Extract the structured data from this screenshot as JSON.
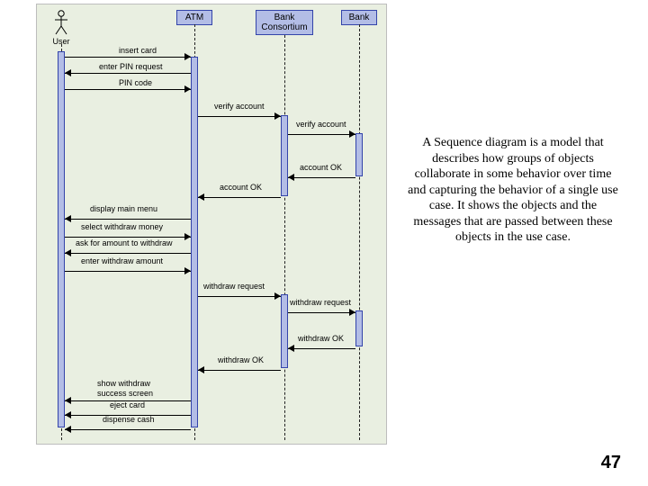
{
  "participants": {
    "user": "User",
    "atm": "ATM",
    "consortium_line1": "Bank",
    "consortium_line2": "Consortium",
    "bank": "Bank"
  },
  "messages": {
    "insert_card": "insert card",
    "enter_pin_request": "enter PIN request",
    "pin_code": "PIN code",
    "verify_account_1": "verify account",
    "verify_account_2": "verify account",
    "account_ok_1": "account OK",
    "account_ok_2": "account OK",
    "display_main_menu": "display main menu",
    "select_withdraw_money": "select withdraw money",
    "ask_for_amount": "ask for amount to withdraw",
    "enter_withdraw_amount": "enter withdraw amount",
    "withdraw_request_1": "withdraw request",
    "withdraw_request_2": "withdraw request",
    "withdraw_ok_1": "withdraw OK",
    "withdraw_ok_2": "withdraw OK",
    "show_withdraw_line1": "show withdraw",
    "show_withdraw_line2": "success screen",
    "eject_card": "eject card",
    "dispense_cash": "dispense cash"
  },
  "description": "A Sequence diagram is a model that describes how groups of objects collaborate in some behavior over time and capturing the behavior of a single use case. It shows the objects and the messages that are passed between these objects in the use case.",
  "page_number": "47"
}
